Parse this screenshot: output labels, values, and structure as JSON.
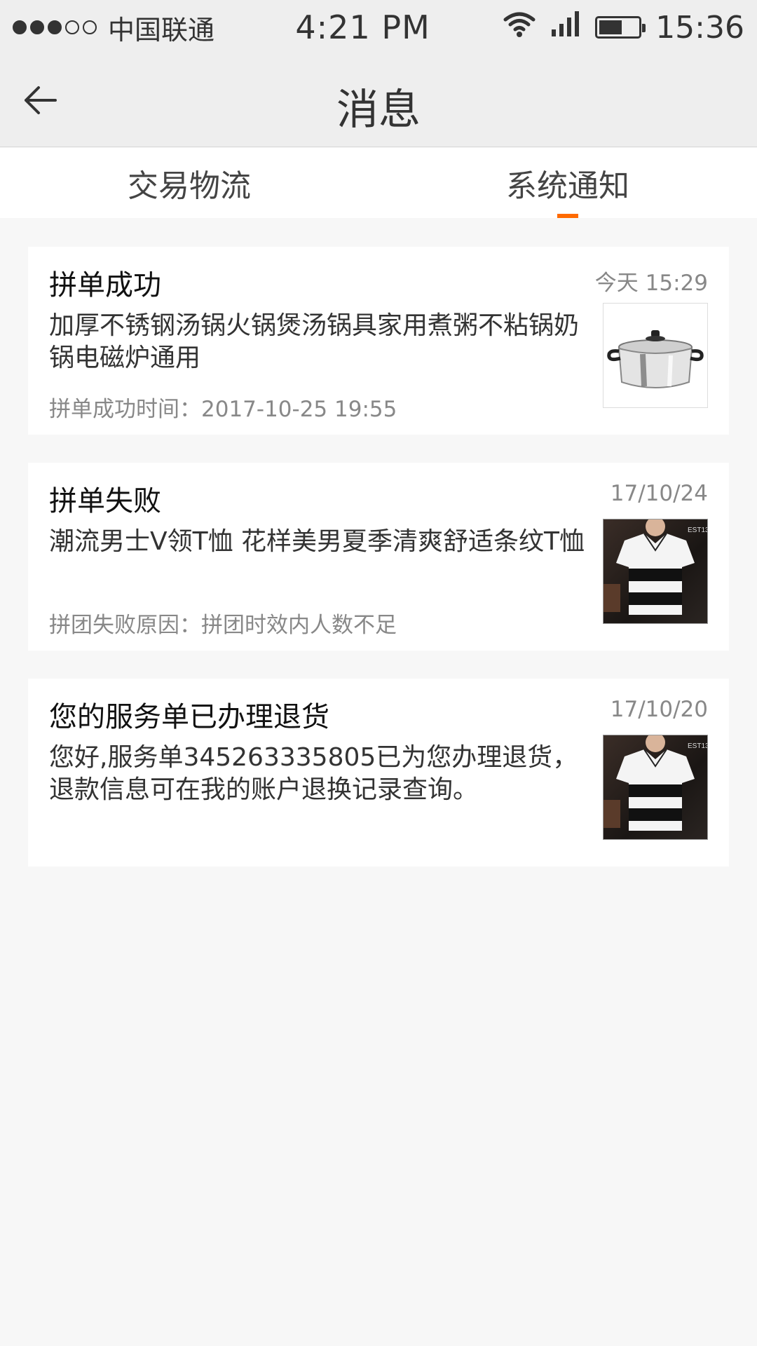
{
  "status_bar": {
    "carrier": "中国联通",
    "clock": "4:21 PM",
    "time": "15:36",
    "signal_dots_filled": 3,
    "signal_dots_total": 5,
    "battery_level": 0.6,
    "icons": [
      "wifi-icon",
      "cell-signal-icon",
      "battery-icon"
    ]
  },
  "header": {
    "title": "消息",
    "back_icon": "arrow-left-icon"
  },
  "tabs": [
    {
      "label": "交易物流",
      "active": false
    },
    {
      "label": "系统通知",
      "active": true
    }
  ],
  "accent_color": "#ff6a00",
  "messages": [
    {
      "title": "拼单成功",
      "date": "今天  15:29",
      "body": "加厚不锈钢汤锅火锅煲汤锅具家用煮粥不粘锅奶锅电磁炉通用",
      "meta": "拼单成功时间：2017-10-25 19:55",
      "thumbnail": "cooking-pot-image"
    },
    {
      "title": "拼单失败",
      "date": "17/10/24",
      "body": "潮流男士V领T恤 花样美男夏季清爽舒适条纹T恤",
      "meta": "拼团失败原因：拼团时效内人数不足",
      "thumbnail": "striped-tshirt-image"
    },
    {
      "title": "您的服务单已办理退货",
      "date": "17/10/20",
      "body": "您好,服务单345263335805已为您办理退货，退款信息可在我的账户退换记录查询。",
      "meta": "",
      "thumbnail": "striped-tshirt-image"
    }
  ]
}
